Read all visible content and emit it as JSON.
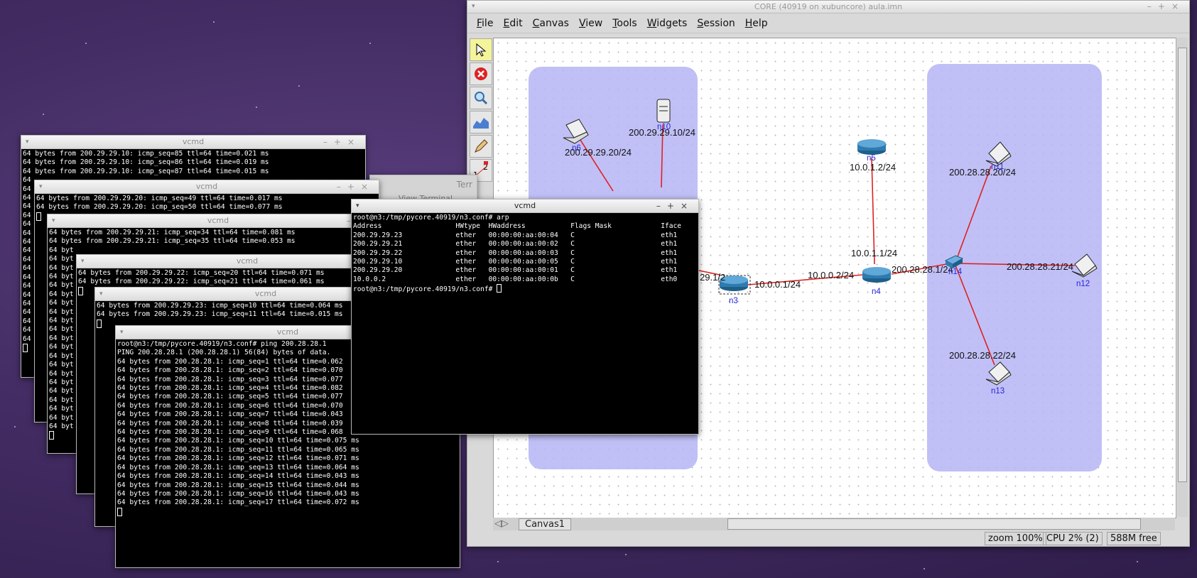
{
  "core": {
    "title": "CORE (40919 on xubuncore) aula.imn",
    "menu": [
      "File",
      "Edit",
      "Canvas",
      "View",
      "Tools",
      "Widgets",
      "Session",
      "Help"
    ],
    "canvas_tab": "Canvas1",
    "status": {
      "zoom": "zoom 100%",
      "cpu": "CPU 2% (2)",
      "mem": "588M free"
    },
    "nodes": {
      "n3": "n3",
      "n4": "n4",
      "n5": "n5",
      "n10": "n10",
      "n11": "n11",
      "n12": "n12",
      "n13": "n13",
      "n14": "n14",
      "n6": "n6"
    },
    "ips": {
      "n6": "200.29.29.20/24",
      "n10": "200.29.29.10/24",
      "n5": "10.0.1.2/24",
      "n11": "200.28.28.20/24",
      "n4_up": "10.0.1.1/24",
      "n4_left": "10.0.0.2/24",
      "n4_right": "200.28.28.1/24",
      "n12": "200.28.28.21/24",
      "n3_right": "10.0.0.1/24",
      "n3_left": "29.29.1/2",
      "n13": "200.28.28.22/24"
    }
  },
  "partial_title": "Terr",
  "partial_tab": "View  Terminal",
  "terminals": [
    {
      "title": "vcmd",
      "lines": [
        "64 bytes from 200.29.29.10: icmp_seq=85 ttl=64 time=0.021 ms",
        "64 bytes from 200.29.29.10: icmp_seq=86 ttl=64 time=0.019 ms",
        "64 bytes from 200.29.29.10: icmp_seq=87 ttl=64 time=0.015 ms",
        "64",
        "64",
        "64",
        "64",
        "64",
        "64",
        "64",
        "64",
        "64",
        "64",
        "64",
        "64",
        "64",
        "64",
        "64",
        "64",
        "64",
        "64",
        "64"
      ]
    },
    {
      "title": "vcmd",
      "lines": [
        "64 bytes from 200.29.29.20: icmp_seq=49 ttl=64 time=0.017 ms",
        "64 bytes from 200.29.29.20: icmp_seq=50 ttl=64 time=0.077 ms"
      ]
    },
    {
      "title": "vcmd",
      "lines": [
        "64 bytes from 200.29.29.21: icmp_seq=34 ttl=64 time=0.081 ms",
        "64 bytes from 200.29.29.21: icmp_seq=35 ttl=64 time=0.053 ms",
        "64 byt",
        "64 byt",
        "64 byt",
        "64 byt",
        "64 byt",
        "64 byt",
        "64 byt",
        "64 byt",
        "64 byt",
        "64 byt",
        "64 byt",
        "64 byt",
        "64 byt",
        "64 byt",
        "64 byt",
        "64 byt",
        "64 byt",
        "64 byt",
        "64 byt",
        "64 byt",
        "64 byt"
      ]
    },
    {
      "title": "vcmd",
      "lines": [
        "64 bytes from 200.29.29.22: icmp_seq=20 ttl=64 time=0.071 ms",
        "64 bytes from 200.29.29.22: icmp_seq=21 ttl=64 time=0.061 ms"
      ]
    },
    {
      "title": "vcmd",
      "lines": [
        "64 bytes from 200.29.29.23: icmp_seq=10 ttl=64 time=0.064 ms",
        "64 bytes from 200.29.29.23: icmp_seq=11 ttl=64 time=0.015 ms"
      ]
    },
    {
      "title": "vcmd",
      "lines": [
        "root@n3:/tmp/pycore.40919/n3.conf# ping 200.28.28.1",
        "PING 200.28.28.1 (200.28.28.1) 56(84) bytes of data.",
        "64 bytes from 200.28.28.1: icmp_seq=1 ttl=64 time=0.062",
        "64 bytes from 200.28.28.1: icmp_seq=2 ttl=64 time=0.070",
        "64 bytes from 200.28.28.1: icmp_seq=3 ttl=64 time=0.077",
        "64 bytes from 200.28.28.1: icmp_seq=4 ttl=64 time=0.082",
        "64 bytes from 200.28.28.1: icmp_seq=5 ttl=64 time=0.077",
        "64 bytes from 200.28.28.1: icmp_seq=6 ttl=64 time=0.070",
        "64 bytes from 200.28.28.1: icmp_seq=7 ttl=64 time=0.043",
        "64 bytes from 200.28.28.1: icmp_seq=8 ttl=64 time=0.039",
        "64 bytes from 200.28.28.1: icmp_seq=9 ttl=64 time=0.068",
        "64 bytes from 200.28.28.1: icmp_seq=10 ttl=64 time=0.075 ms",
        "64 bytes from 200.28.28.1: icmp_seq=11 ttl=64 time=0.065 ms",
        "64 bytes from 200.28.28.1: icmp_seq=12 ttl=64 time=0.071 ms",
        "64 bytes from 200.28.28.1: icmp_seq=13 ttl=64 time=0.064 ms",
        "64 bytes from 200.28.28.1: icmp_seq=14 ttl=64 time=0.043 ms",
        "64 bytes from 200.28.28.1: icmp_seq=15 ttl=64 time=0.044 ms",
        "64 bytes from 200.28.28.1: icmp_seq=16 ttl=64 time=0.043 ms",
        "64 bytes from 200.28.28.1: icmp_seq=17 ttl=64 time=0.072 ms"
      ]
    },
    {
      "title": "vcmd",
      "lines": [
        "root@n3:/tmp/pycore.40919/n3.conf# arp",
        "Address                  HWtype  HWaddress           Flags Mask            Iface",
        "200.29.29.23             ether   00:00:00:aa:00:04   C                     eth1",
        "200.29.29.21             ether   00:00:00:aa:00:02   C                     eth1",
        "200.29.29.22             ether   00:00:00:aa:00:03   C                     eth1",
        "200.29.29.10             ether   00:00:00:aa:00:05   C                     eth1",
        "200.29.29.20             ether   00:00:00:aa:00:01   C                     eth1",
        "10.0.0.2                 ether   00:00:00:aa:00:0b   C                     eth0",
        "root@n3:/tmp/pycore.40919/n3.conf# "
      ]
    }
  ]
}
